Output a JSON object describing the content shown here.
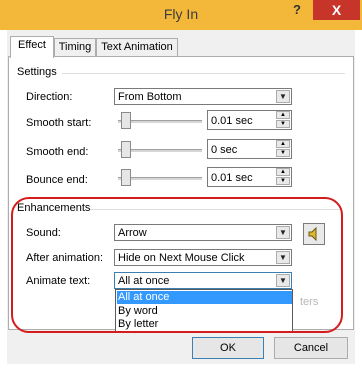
{
  "window": {
    "title": "Fly In",
    "help": "?",
    "close": "X"
  },
  "tabs": [
    "Effect",
    "Timing",
    "Text Animation"
  ],
  "settings": {
    "heading": "Settings",
    "direction_label": "Direction:",
    "direction_value": "From Bottom",
    "smooth_start_label": "Smooth start:",
    "smooth_start_value": "0.01 sec",
    "smooth_end_label": "Smooth end:",
    "smooth_end_value": "0 sec",
    "bounce_end_label": "Bounce end:",
    "bounce_end_value": "0.01 sec"
  },
  "enhancements": {
    "heading": "Enhancements",
    "sound_label": "Sound:",
    "sound_value": "Arrow",
    "after_animation_label": "After animation:",
    "after_animation_value": "Hide on Next Mouse Click",
    "animate_text_label": "Animate text:",
    "animate_text_value": "All at once",
    "animate_text_options": [
      "All at once",
      "By word",
      "By letter"
    ],
    "selected_option": "All at once",
    "partially_hidden_text": "ters"
  },
  "buttons": {
    "ok": "OK",
    "cancel": "Cancel"
  },
  "colors": {
    "titlebar": "#f3b73a",
    "close": "#c7352a",
    "highlight_ring": "#d41c1c",
    "selection": "#3399ff"
  }
}
